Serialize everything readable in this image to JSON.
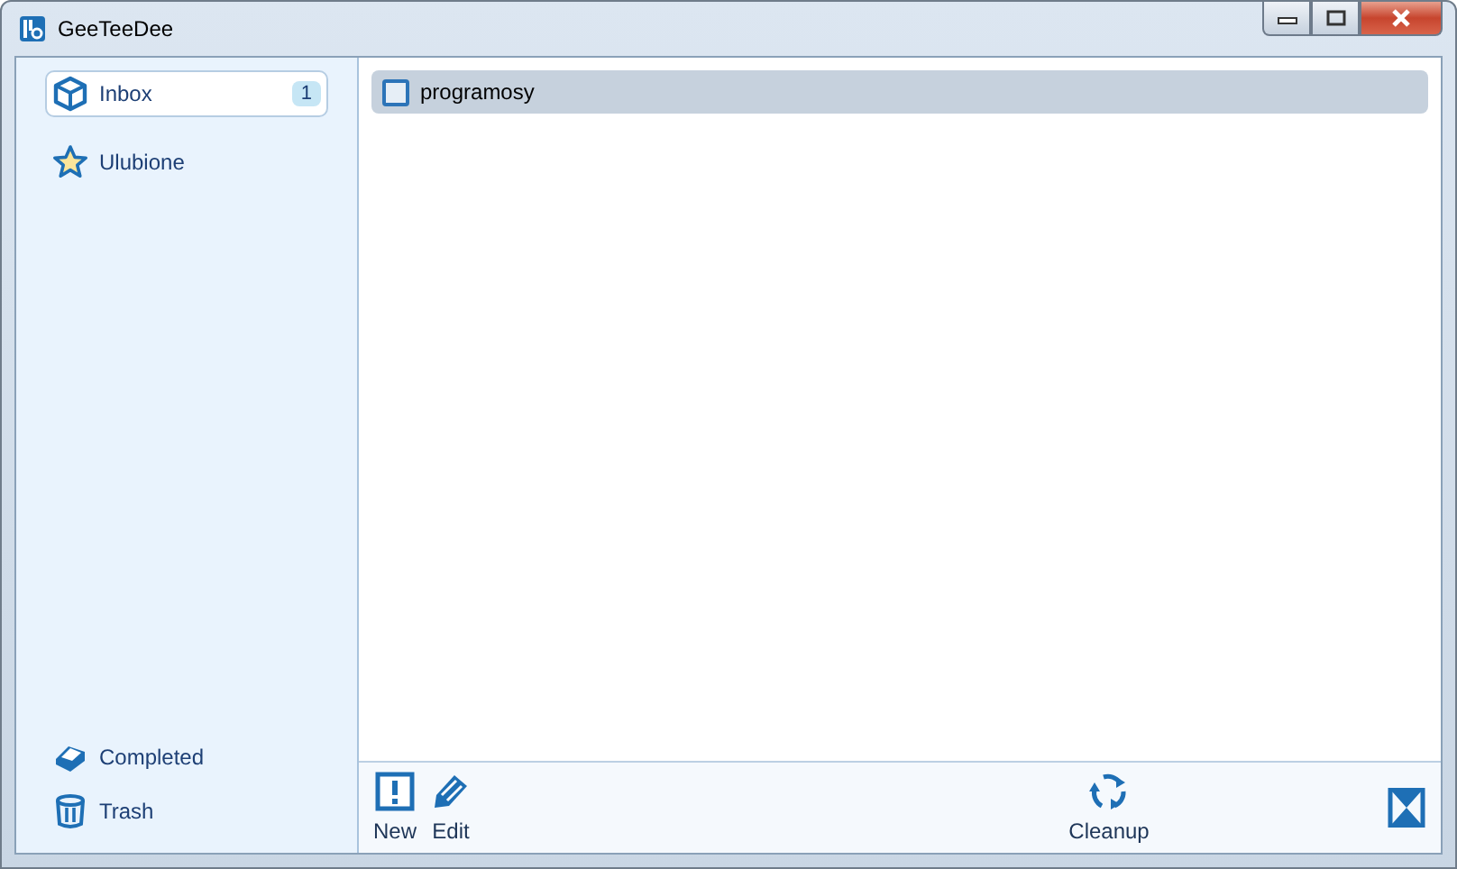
{
  "window": {
    "title": "GeeTeeDee"
  },
  "sidebar": {
    "items": [
      {
        "kind": "inbox",
        "label": "Inbox",
        "count": "1",
        "selected": true
      },
      {
        "kind": "star",
        "label": "Ulubione",
        "selected": false
      }
    ],
    "bottom_items": [
      {
        "kind": "completed",
        "label": "Completed",
        "selected": false
      },
      {
        "kind": "trash",
        "label": "Trash",
        "selected": false
      }
    ]
  },
  "tasks": [
    {
      "title": "programosy",
      "checked": false,
      "selected": true
    }
  ],
  "toolbar": {
    "left": [
      {
        "kind": "new",
        "label": "New"
      },
      {
        "kind": "edit",
        "label": "Edit"
      }
    ],
    "center": [
      {
        "kind": "cleanup",
        "label": "Cleanup"
      }
    ],
    "right": [
      {
        "kind": "hourglass"
      }
    ]
  }
}
